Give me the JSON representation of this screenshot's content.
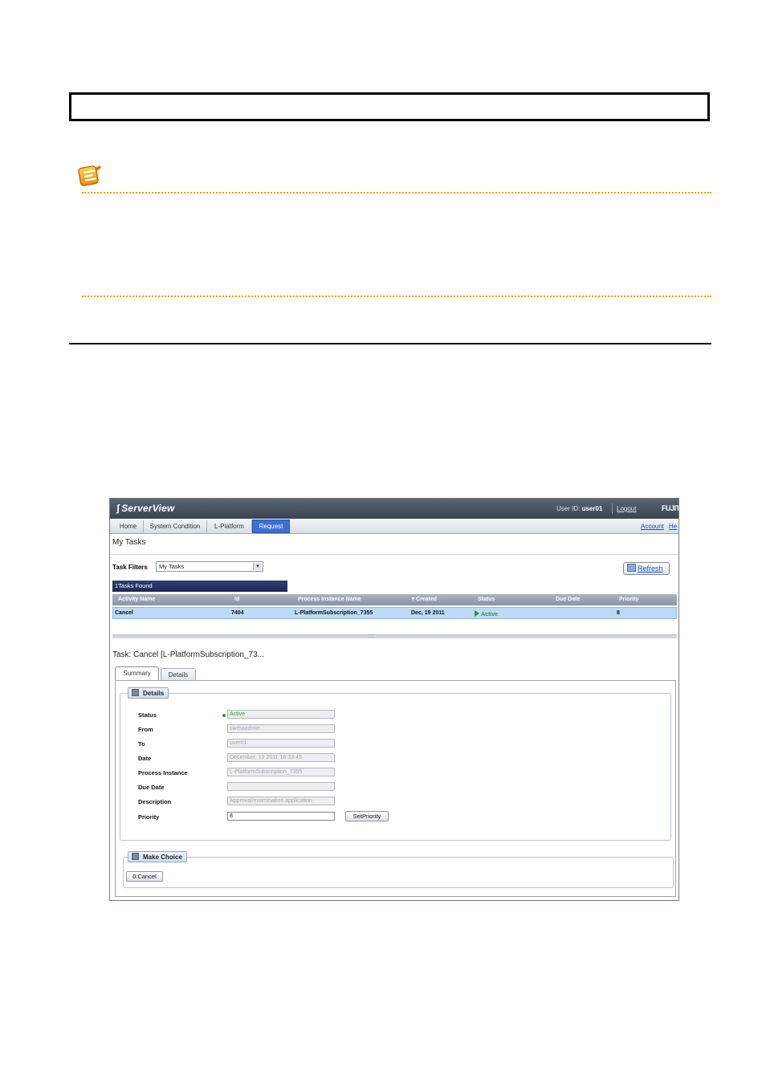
{
  "app": {
    "logo": "ServerView",
    "user_id_label": "User ID:",
    "user_id": "user01",
    "logout": "Logout",
    "brand": "FUJITSU",
    "tabs": [
      "Home",
      "System Condition",
      "L-Platform",
      "Request"
    ],
    "active_tab": "Request",
    "account_link": "Account",
    "help_link": "He",
    "page_title": "My Tasks",
    "task_filters_label": "Task Filters",
    "task_filter_value": "My Tasks",
    "refresh_label": "Refresh",
    "tasks_found": "1Tasks Found",
    "table": {
      "columns": [
        "Activity Name",
        "Id",
        "Process Instance Name",
        "Created",
        "Status",
        "Due Date",
        "Priority"
      ],
      "sort_marker": "▼",
      "rows": [
        {
          "activity": "Cancel",
          "id": "7404",
          "process": "L-PlatformSubscription_7355",
          "created": "Dec, 19 2011",
          "status": "Active",
          "due": "",
          "priority": "8"
        }
      ]
    },
    "splitter_grip": "::::",
    "task_title": "Task: Cancel [L-PlatformSubscription_73...",
    "detail_tabs": [
      "Summary",
      "Details"
    ],
    "details_legend": "Details",
    "fields": {
      "status_label": "Status",
      "status_value": "Active",
      "from_label": "From",
      "from_value": "swrbaadmin",
      "to_label": "To",
      "to_value": "user01",
      "date_label": "Date",
      "date_value": "December, 19 2011 16:33:45",
      "process_label": "Process Instance",
      "process_value": "L-PlatformSubscription_7355",
      "due_label": "Due Date",
      "due_value": "",
      "desc_label": "Description",
      "desc_value": "Approval/examination application",
      "priority_label": "Priority",
      "priority_value": "8"
    },
    "set_priority_button": "SetPriority",
    "make_choice_legend": "Make Choice",
    "choice_button": "0:Cancel"
  },
  "colors": {
    "topbar": "#3b4450",
    "active_tab": "#3f6fd1",
    "selected_row": "#bcd9f6",
    "status_green": "#2b9b2b",
    "note_rule": "#e5a000"
  }
}
